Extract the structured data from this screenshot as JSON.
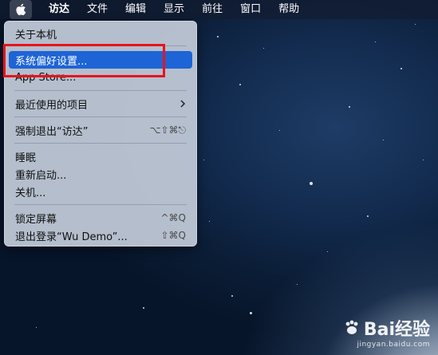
{
  "menubar": {
    "apple_icon": "apple-logo-icon",
    "items": [
      "访达",
      "文件",
      "编辑",
      "显示",
      "前往",
      "窗口",
      "帮助"
    ]
  },
  "apple_menu": {
    "about": "关于本机",
    "system_prefs": "系统偏好设置...",
    "app_store": "App Store...",
    "recent_items": "最近使用的项目",
    "force_quit": "强制退出“访达”",
    "force_quit_shortcut": "⌥⇧⌘⎋",
    "sleep": "睡眠",
    "restart": "重新启动...",
    "shutdown": "关机...",
    "lock_screen": "锁定屏幕",
    "lock_screen_shortcut": "^⌘Q",
    "logout": "退出登录“Wu Demo”...",
    "logout_shortcut": "⇧⌘Q",
    "highlighted_item": "系统偏好设置..."
  },
  "watermark": {
    "brand": "Bai经验",
    "url": "jingyan.baidu.com"
  },
  "colors": {
    "highlight": "#1d64d6",
    "annotation_box": "#e8131b"
  }
}
